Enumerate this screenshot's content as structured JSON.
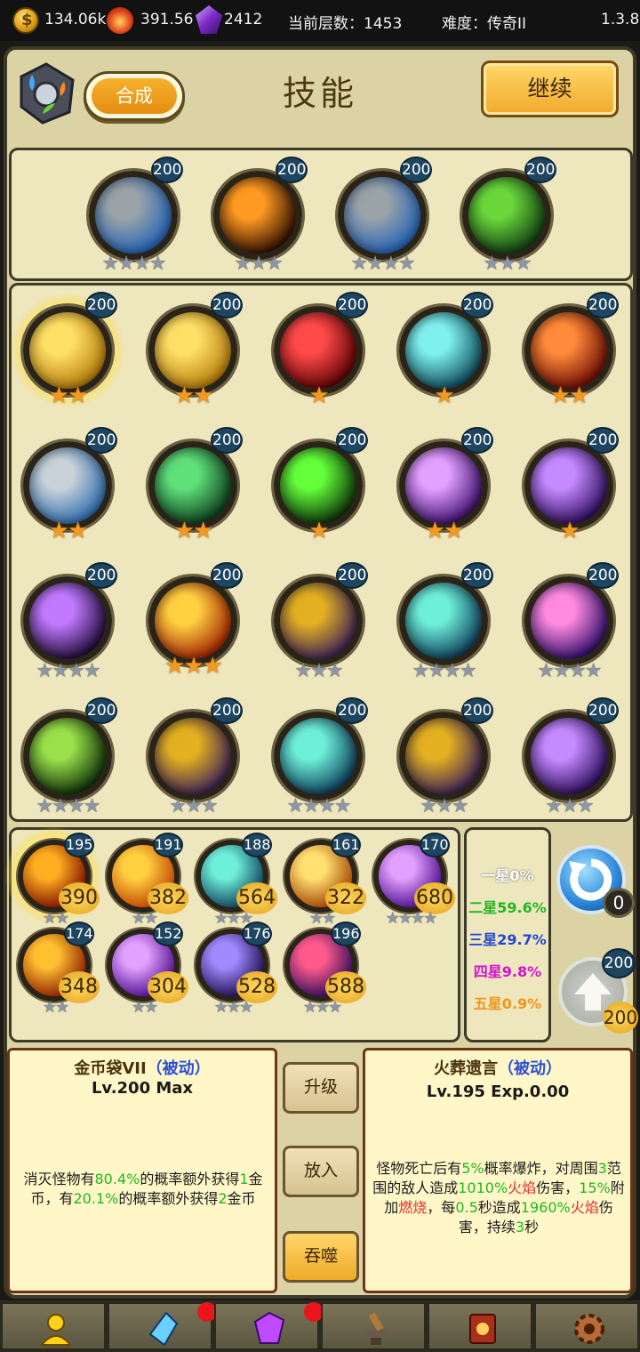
{
  "topbar": {
    "coins": "134.06k",
    "fire": "391.56k",
    "gems": "2412",
    "floor_label": "当前层数：1453",
    "difficulty_label": "难度：传奇II",
    "version": "1.3.8"
  },
  "header": {
    "title": "技能",
    "compose_label": "合成",
    "continue_label": "继续"
  },
  "equipped": [
    {
      "icon": "rock-icon",
      "level": "200",
      "stars": "★★★★",
      "colors": [
        "#9aa3a8",
        "#2062b8"
      ]
    },
    {
      "icon": "holy-cross-icon",
      "level": "200",
      "stars": "★★★",
      "colors": [
        "#ff9a22",
        "#2a0c00"
      ]
    },
    {
      "icon": "rock-icon",
      "level": "200",
      "stars": "★★★★",
      "colors": [
        "#9aa3a8",
        "#2062b8"
      ]
    },
    {
      "icon": "vine-icon",
      "level": "200",
      "stars": "★★★",
      "colors": [
        "#6bd63c",
        "#0d3a10"
      ]
    }
  ],
  "skills": [
    {
      "icon": "coin-bag-icon",
      "level": "200",
      "stars": "★★",
      "star_color": "gold",
      "colors": [
        "#ffe066",
        "#b47a08"
      ],
      "selected": true
    },
    {
      "icon": "coin-bag-icon",
      "level": "200",
      "stars": "★★",
      "star_color": "gold",
      "colors": [
        "#ffe066",
        "#b47a08"
      ]
    },
    {
      "icon": "blood-drop-icon",
      "level": "200",
      "stars": "★",
      "star_color": "gold",
      "colors": [
        "#ff4a4a",
        "#5a0000"
      ]
    },
    {
      "icon": "ice-shard-icon",
      "level": "200",
      "stars": "★",
      "star_color": "gold",
      "colors": [
        "#7ff0ee",
        "#0b4a5a"
      ]
    },
    {
      "icon": "berserker-icon",
      "level": "200",
      "stars": "★★",
      "star_color": "gold",
      "colors": [
        "#ff8a3a",
        "#6a0a00"
      ]
    },
    {
      "icon": "rock-icon",
      "level": "200",
      "stars": "★★",
      "star_color": "gold",
      "colors": [
        "#c9d2d8",
        "#2a6bb0"
      ]
    },
    {
      "icon": "poison-wind-icon",
      "level": "200",
      "stars": "★★",
      "star_color": "gold",
      "colors": [
        "#5fe07a",
        "#0a3a1a"
      ]
    },
    {
      "icon": "skull-icon",
      "level": "200",
      "stars": "★",
      "star_color": "gold",
      "colors": [
        "#62ff3a",
        "#0a2a06"
      ]
    },
    {
      "icon": "arcane-burst-icon",
      "level": "200",
      "stars": "★★",
      "star_color": "gold",
      "colors": [
        "#e2a0ff",
        "#3a0a6a"
      ]
    },
    {
      "icon": "lightning-icon",
      "level": "200",
      "stars": "★",
      "star_color": "gold",
      "colors": [
        "#c58aff",
        "#2a0a5a"
      ]
    },
    {
      "icon": "shadow-claw-icon",
      "level": "200",
      "stars": "★★★★",
      "star_color": "gray",
      "colors": [
        "#c17aff",
        "#1a0830"
      ]
    },
    {
      "icon": "explosion-icon",
      "level": "200",
      "stars": "★★★",
      "star_color": "gold",
      "colors": [
        "#ffd040",
        "#a01e00"
      ]
    },
    {
      "icon": "magma-icon",
      "level": "200",
      "stars": "★★★",
      "star_color": "gray",
      "colors": [
        "#e2b020",
        "#3a1e5a"
      ]
    },
    {
      "icon": "teal-slash-icon",
      "level": "200",
      "stars": "★★★★",
      "star_color": "gray",
      "colors": [
        "#6ef0d8",
        "#0a3a5a"
      ]
    },
    {
      "icon": "pink-orb-icon",
      "level": "200",
      "stars": "★★★★",
      "star_color": "gray",
      "colors": [
        "#ff8ae0",
        "#2a0a6a"
      ]
    },
    {
      "icon": "green-beast-icon",
      "level": "200",
      "stars": "★★★★",
      "star_color": "gray",
      "colors": [
        "#9ae04a",
        "#0a2a06"
      ]
    },
    {
      "icon": "magma-icon",
      "level": "200",
      "stars": "★★★",
      "star_color": "gray",
      "colors": [
        "#e2b020",
        "#3a1e5a"
      ]
    },
    {
      "icon": "teal-slash-icon",
      "level": "200",
      "stars": "★★★★",
      "star_color": "gray",
      "colors": [
        "#6ef0d8",
        "#0a3a5a"
      ]
    },
    {
      "icon": "magma-icon",
      "level": "200",
      "stars": "★★★",
      "star_color": "gray",
      "colors": [
        "#e2b020",
        "#3a1e5a"
      ]
    },
    {
      "icon": "lightning-icon",
      "level": "200",
      "stars": "★★★",
      "star_color": "gray",
      "colors": [
        "#c58aff",
        "#2a0a5a"
      ]
    }
  ],
  "inventory": [
    {
      "icon": "cremation-icon",
      "level": "195",
      "count": "390",
      "stars": "★★",
      "colors": [
        "#ffb020",
        "#7a0a00"
      ],
      "selected": true
    },
    {
      "icon": "fire-swirl-icon",
      "level": "191",
      "count": "382",
      "stars": "★★",
      "colors": [
        "#ffd040",
        "#c04000"
      ]
    },
    {
      "icon": "teal-slash-icon",
      "level": "188",
      "count": "564",
      "stars": "★★★",
      "colors": [
        "#6ef0d8",
        "#0a3a5a"
      ]
    },
    {
      "icon": "warrior-icon",
      "level": "161",
      "count": "322",
      "stars": "★★",
      "colors": [
        "#ffe070",
        "#a04000"
      ]
    },
    {
      "icon": "purple-star-icon",
      "level": "170",
      "count": "680",
      "stars": "★★★★",
      "colors": [
        "#e2a0ff",
        "#4a0a8a"
      ]
    },
    {
      "icon": "flame-icon",
      "level": "174",
      "count": "348",
      "stars": "★★",
      "colors": [
        "#ffc030",
        "#8a1a00"
      ]
    },
    {
      "icon": "purple-star-icon",
      "level": "152",
      "count": "304",
      "stars": "★★",
      "colors": [
        "#e2a0ff",
        "#4a0a8a"
      ]
    },
    {
      "icon": "dark-claw-icon",
      "level": "176",
      "count": "528",
      "stars": "★★★",
      "colors": [
        "#a08aff",
        "#1a0a4a"
      ]
    },
    {
      "icon": "nebula-icon",
      "level": "196",
      "count": "588",
      "stars": "★★★",
      "colors": [
        "#ff5a8a",
        "#2a0a5a"
      ]
    }
  ],
  "rates": {
    "one": "一星0%",
    "two": "二星59.6%",
    "three": "三星29.7%",
    "four": "四星9.8%",
    "five": "五星0.9%"
  },
  "side": {
    "refresh_count": "0",
    "upgrade_level": "200",
    "upgrade_cost": "200"
  },
  "left_desc": {
    "title": "金币袋VII",
    "tag": "（被动）",
    "subtitle": "Lv.200 Max",
    "segments": [
      "消灭怪物有",
      "80.4%",
      "的概率额外获得",
      "1",
      "金币，有",
      "20.1%",
      "的概率额外获得",
      "2",
      "金币"
    ]
  },
  "right_desc": {
    "title": "火葬遗言",
    "tag": "（被动）",
    "subtitle": "Lv.195 Exp.0.00",
    "segments": [
      "怪物死亡后有",
      "5%",
      "概率爆炸，对周围",
      "3",
      "范围的敌人造成",
      "1010%",
      "火焰",
      "伤害，",
      "15%",
      "附加",
      "燃烧",
      "，每",
      "0.5",
      "秒造成",
      "1960%",
      "火焰",
      "伤害，持续",
      "3",
      "秒"
    ]
  },
  "actions": {
    "upgrade": "升级",
    "insert": "放入",
    "devour": "吞噬"
  },
  "tabs": [
    {
      "icon": "hero-icon"
    },
    {
      "icon": "crystal-icon",
      "badge": true
    },
    {
      "icon": "purple-gem-icon",
      "badge": true
    },
    {
      "icon": "anvil-icon"
    },
    {
      "icon": "spellbook-icon"
    },
    {
      "icon": "settings-gear-icon"
    }
  ]
}
